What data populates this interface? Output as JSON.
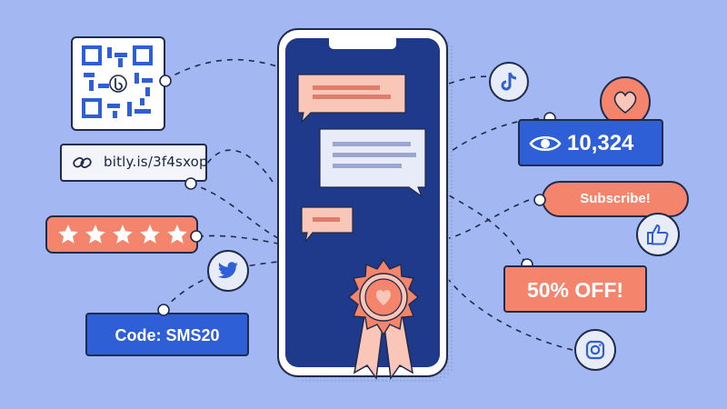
{
  "link": {
    "url": "bitly.is/3f4sxop",
    "icon": "link-icon"
  },
  "qr": {
    "icon": "qr-code-icon",
    "logo": "bitly-logo-icon"
  },
  "rating": {
    "stars": 5,
    "icon": "star-icon"
  },
  "promo_code": {
    "label": "Code: SMS20"
  },
  "views": {
    "count": "10,324",
    "icon": "eye-icon"
  },
  "subscribe": {
    "label": "Subscribe!"
  },
  "offer": {
    "label": "50% OFF!"
  },
  "social_icons": [
    "tiktok-icon",
    "twitter-icon",
    "instagram-icon",
    "thumbs-up-icon",
    "heart-icon"
  ],
  "colors": {
    "background": "#a3b8f2",
    "phone_screen": "#1f3a8a",
    "brand_blue": "#2f5fd6",
    "accent_coral": "#f4846c",
    "outline": "#1f2b4a",
    "bubble_pink": "#f9c6b8",
    "bubble_light": "#e8ecf8"
  }
}
